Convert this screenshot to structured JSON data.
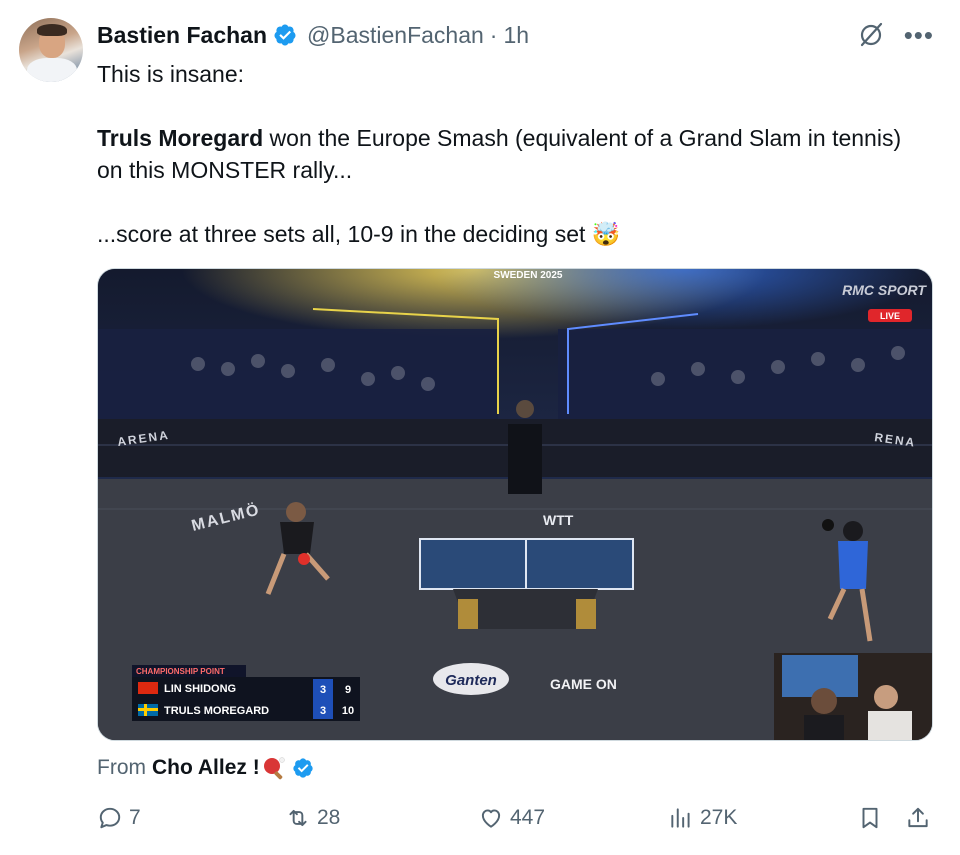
{
  "author": {
    "name": "Bastien Fachan",
    "handle": "@BastienFachan",
    "separator": "·",
    "time": "1h"
  },
  "post": {
    "line1": "This is insane:",
    "line2_bold": "Truls Moregard",
    "line2_rest": " won the Europe Smash (equivalent of a Grand Slam in tennis) on this MONSTER rally...",
    "line3": "...score at three sets all, 10-9 in the deciding set 🤯"
  },
  "media": {
    "event_banner": "SWEDEN 2025",
    "broadcaster": "RMC SPORT",
    "live_badge": "LIVE",
    "score_title": "CHAMPIONSHIP POINT",
    "players": [
      {
        "name": "LIN SHIDONG",
        "sets": "3",
        "points": "9"
      },
      {
        "name": "TRULS MOREGARD",
        "sets": "3",
        "points": "10"
      }
    ],
    "floor_text_left": "MALMÖ",
    "wtt_label": "WTT",
    "arena_left": "ARENA",
    "arena_right": "RENA",
    "sponsor_gameon": "GAME ON",
    "sponsor_ganten": "Ganten"
  },
  "source": {
    "prefix": "From",
    "name": "Cho Allez !"
  },
  "actions": {
    "replies": "7",
    "reposts": "28",
    "likes": "447",
    "views": "27K"
  },
  "icons": {
    "verified": "verified-badge-icon",
    "grok": "grok-icon",
    "more": "more-icon",
    "reply": "reply-icon",
    "repost": "repost-icon",
    "like": "heart-icon",
    "views": "views-icon",
    "bookmark": "bookmark-icon",
    "share": "share-icon"
  },
  "colors": {
    "accent": "#1d9bf0",
    "muted": "#536471",
    "text": "#0f1419"
  }
}
